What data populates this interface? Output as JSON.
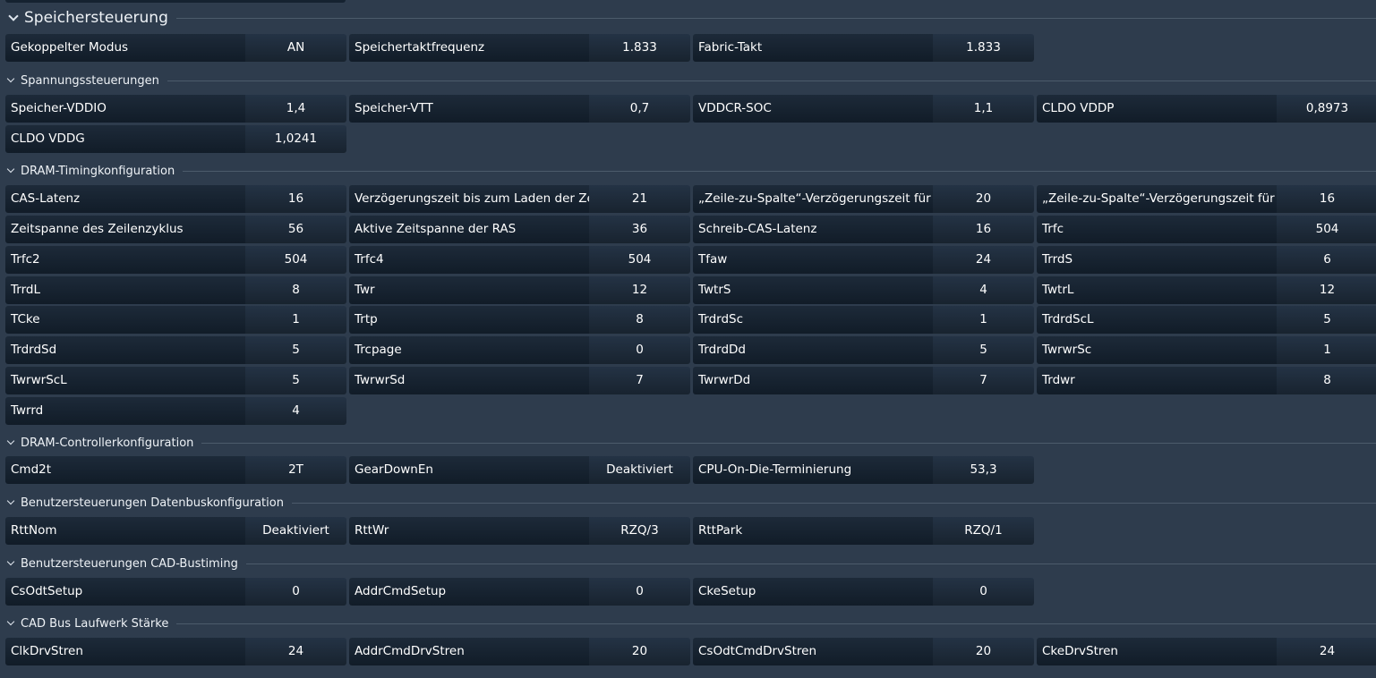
{
  "sections": [
    {
      "title": "Speichersteuerung",
      "rows": [
        [
          {
            "label": "Gekoppelter Modus",
            "value": "AN"
          },
          {
            "label": "Speichertaktfrequenz",
            "value": "1.833"
          },
          {
            "label": "Fabric-Takt",
            "value": "1.833"
          }
        ]
      ]
    },
    {
      "title": "Spannungssteuerungen",
      "rows": [
        [
          {
            "label": "Speicher-VDDIO",
            "value": "1,4"
          },
          {
            "label": "Speicher-VTT",
            "value": "0,7"
          },
          {
            "label": "VDDCR-SOC",
            "value": "1,1"
          },
          {
            "label": "CLDO VDDP",
            "value": "0,8973"
          }
        ],
        [
          {
            "label": "CLDO VDDG",
            "value": "1,0241"
          }
        ]
      ]
    },
    {
      "title": "DRAM-Timingkonfiguration",
      "rows": [
        [
          {
            "label": "CAS-Latenz",
            "value": "16"
          },
          {
            "label": "Verzögerungszeit bis zum Laden der Zeile",
            "value": "21"
          },
          {
            "label": "„Zeile-zu-Spalte“-Verzögerungszeit für L...",
            "value": "20"
          },
          {
            "label": "„Zeile-zu-Spalte“-Verzögerungszeit für S...",
            "value": "16"
          }
        ],
        [
          {
            "label": "Zeitspanne des Zeilenzyklus",
            "value": "56"
          },
          {
            "label": "Aktive Zeitspanne der RAS",
            "value": "36"
          },
          {
            "label": "Schreib-CAS-Latenz",
            "value": "16"
          },
          {
            "label": "Trfc",
            "value": "504"
          }
        ],
        [
          {
            "label": "Trfc2",
            "value": "504"
          },
          {
            "label": "Trfc4",
            "value": "504"
          },
          {
            "label": "Tfaw",
            "value": "24"
          },
          {
            "label": "TrrdS",
            "value": "6"
          }
        ],
        [
          {
            "label": "TrrdL",
            "value": "8"
          },
          {
            "label": "Twr",
            "value": "12"
          },
          {
            "label": "TwtrS",
            "value": "4"
          },
          {
            "label": "TwtrL",
            "value": "12"
          }
        ],
        [
          {
            "label": "TCke",
            "value": "1"
          },
          {
            "label": "Trtp",
            "value": "8"
          },
          {
            "label": "TrdrdSc",
            "value": "1"
          },
          {
            "label": "TrdrdScL",
            "value": "5"
          }
        ],
        [
          {
            "label": "TrdrdSd",
            "value": "5"
          },
          {
            "label": "Trcpage",
            "value": "0"
          },
          {
            "label": "TrdrdDd",
            "value": "5"
          },
          {
            "label": "TwrwrSc",
            "value": "1"
          }
        ],
        [
          {
            "label": "TwrwrScL",
            "value": "5"
          },
          {
            "label": "TwrwrSd",
            "value": "7"
          },
          {
            "label": "TwrwrDd",
            "value": "7"
          },
          {
            "label": "Trdwr",
            "value": "8"
          }
        ],
        [
          {
            "label": "Twrrd",
            "value": "4"
          }
        ]
      ]
    },
    {
      "title": "DRAM-Controllerkonfiguration",
      "rows": [
        [
          {
            "label": "Cmd2t",
            "value": "2T"
          },
          {
            "label": "GearDownEn",
            "value": "Deaktiviert"
          },
          {
            "label": "CPU-On-Die-Terminierung",
            "value": "53,3"
          }
        ]
      ]
    },
    {
      "title": "Benutzersteuerungen Datenbuskonfiguration",
      "rows": [
        [
          {
            "label": "RttNom",
            "value": "Deaktiviert"
          },
          {
            "label": "RttWr",
            "value": "RZQ/3"
          },
          {
            "label": "RttPark",
            "value": "RZQ/1"
          }
        ]
      ]
    },
    {
      "title": "Benutzersteuerungen CAD-Bustiming",
      "rows": [
        [
          {
            "label": "CsOdtSetup",
            "value": "0"
          },
          {
            "label": "AddrCmdSetup",
            "value": "0"
          },
          {
            "label": "CkeSetup",
            "value": "0"
          }
        ]
      ]
    },
    {
      "title": "CAD Bus Laufwerk Stärke",
      "rows": [
        [
          {
            "label": "ClkDrvStren",
            "value": "24"
          },
          {
            "label": "AddrCmdDrvStren",
            "value": "20"
          },
          {
            "label": "CsOdtCmdDrvStren",
            "value": "20"
          },
          {
            "label": "CkeDrvStren",
            "value": "24"
          }
        ]
      ]
    }
  ]
}
